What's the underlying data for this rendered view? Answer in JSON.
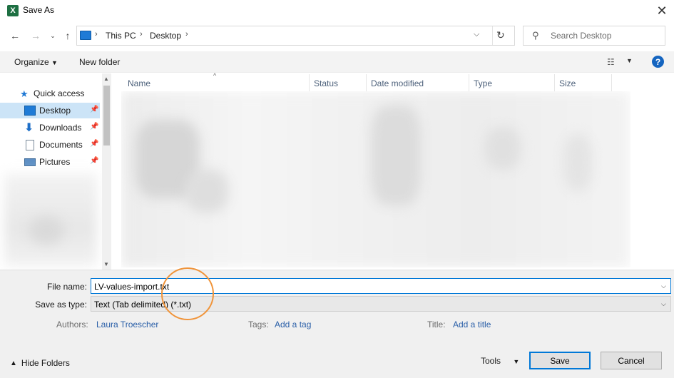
{
  "window": {
    "title": "Save As",
    "app_icon_letter": "X"
  },
  "address": {
    "crumbs": [
      "This PC",
      "Desktop"
    ],
    "search_placeholder": "Search Desktop"
  },
  "toolbar": {
    "organize": "Organize",
    "new_folder": "New folder"
  },
  "navpane": {
    "quick_access": "Quick access",
    "items": [
      {
        "label": "Desktop",
        "icon": "desktop-icon",
        "selected": true
      },
      {
        "label": "Downloads",
        "icon": "download-icon",
        "selected": false
      },
      {
        "label": "Documents",
        "icon": "document-icon",
        "selected": false
      },
      {
        "label": "Pictures",
        "icon": "pictures-icon",
        "selected": false
      }
    ]
  },
  "columns": [
    "Name",
    "Status",
    "Date modified",
    "Type",
    "Size"
  ],
  "form": {
    "file_name_label": "File name:",
    "file_name_value": "LV-values-import.txt",
    "save_type_label": "Save as type:",
    "save_type_value": "Text (Tab delimited) (*.txt)",
    "authors_label": "Authors:",
    "authors_value": "Laura Troescher",
    "tags_label": "Tags:",
    "tags_value": "Add a tag",
    "title_label": "Title:",
    "title_value": "Add a title"
  },
  "footer": {
    "hide_folders": "Hide Folders",
    "tools": "Tools",
    "save": "Save",
    "cancel": "Cancel"
  },
  "colors": {
    "accent": "#0078d7",
    "annotation": "#f0943a",
    "selected_bg": "#cce4f7"
  }
}
